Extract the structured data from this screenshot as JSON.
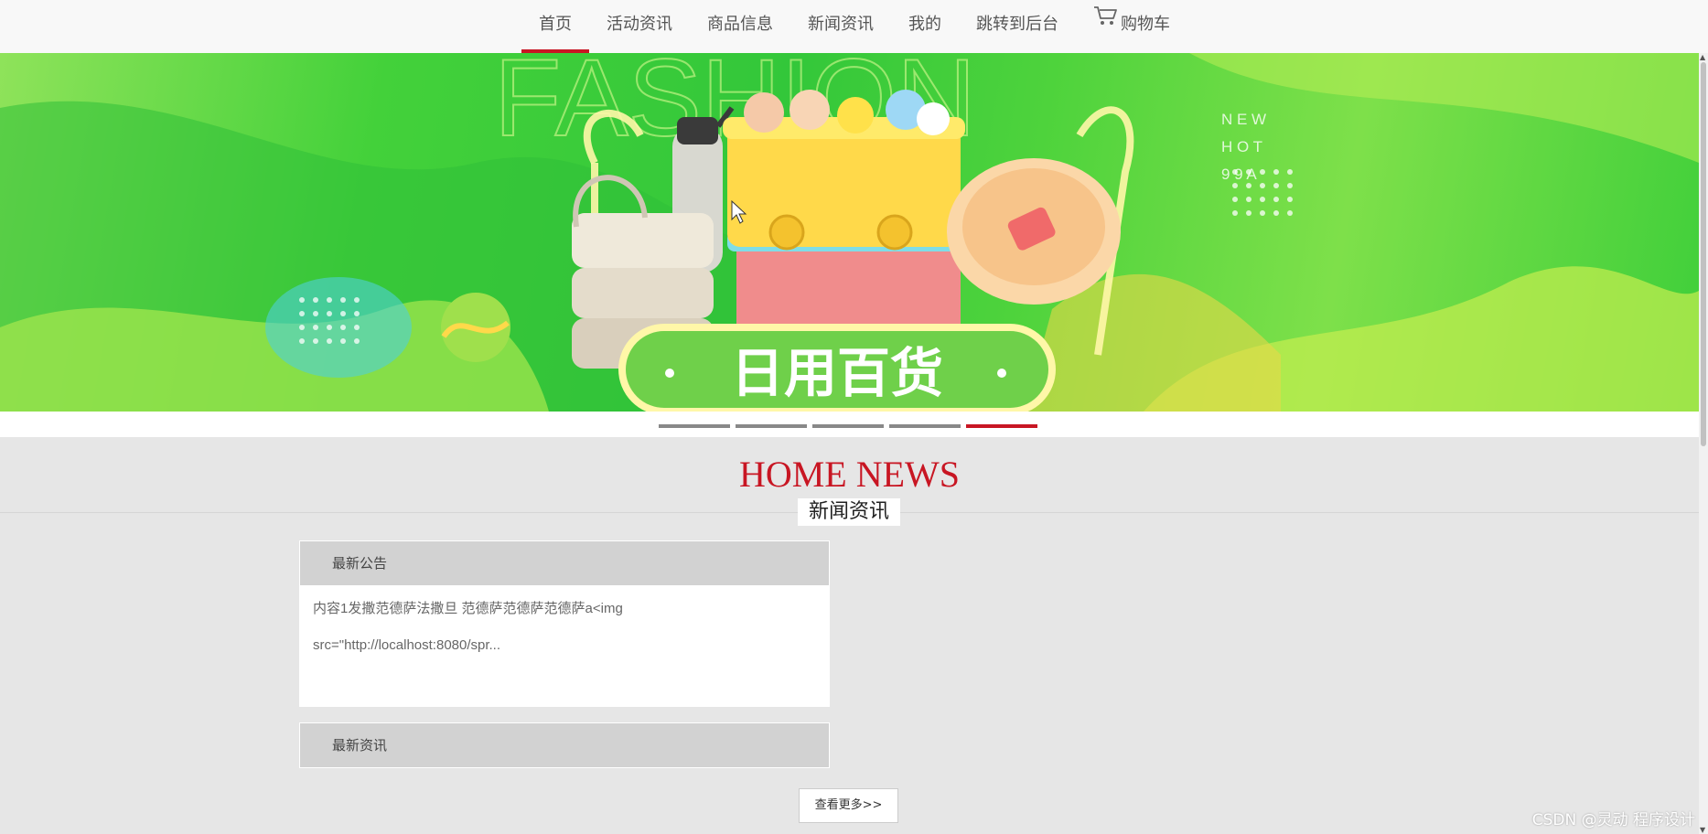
{
  "nav": {
    "items": [
      {
        "label": "首页",
        "active": true
      },
      {
        "label": "活动资讯",
        "active": false
      },
      {
        "label": "商品信息",
        "active": false
      },
      {
        "label": "新闻资讯",
        "active": false
      },
      {
        "label": "我的",
        "active": false
      },
      {
        "label": "跳转到后台",
        "active": false
      },
      {
        "label": "购物车",
        "active": false,
        "icon": "cart-icon"
      }
    ]
  },
  "banner": {
    "faded_text": "FASHION",
    "side_text": [
      "N E W",
      "H O T",
      "9 9 A"
    ],
    "caption": "日用百货",
    "slide_count": 5,
    "active_slide": 5
  },
  "news": {
    "heading": "HOME NEWS",
    "subheading": "新闻资讯",
    "announcement_title": "最新公告",
    "announcement_lines": [
      "内容1发撒范德萨法撒旦 范德萨范德萨范德萨a<img",
      "src=\"http://localhost:8080/spr..."
    ],
    "latest_title": "最新资讯",
    "more_label": "查看更多>>"
  },
  "watermark": "CSDN @灵动 程序设计",
  "colors": {
    "accent": "#c81623",
    "nav_bg": "#f8f8f8",
    "page_bg": "#e6e6e6"
  }
}
